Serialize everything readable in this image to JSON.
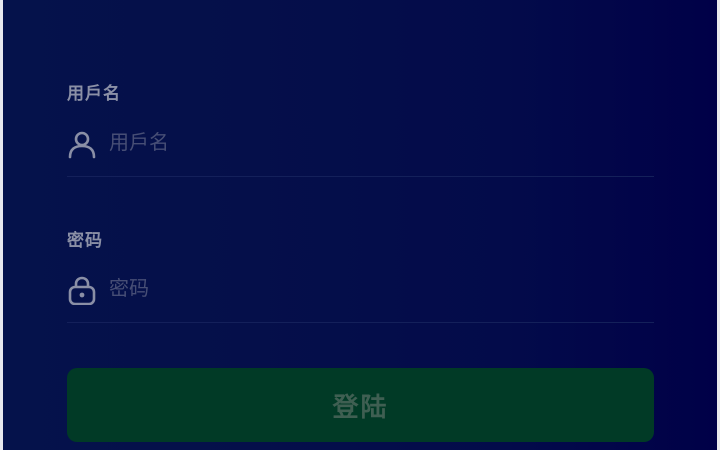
{
  "form": {
    "username": {
      "label": "用戶名",
      "placeholder": "用戶名",
      "value": "",
      "icon": "user-icon"
    },
    "password": {
      "label": "密码",
      "placeholder": "密码",
      "value": "",
      "icon": "lock-icon"
    },
    "submit_label": "登陆"
  },
  "colors": {
    "background": "#050f4a",
    "button": "#013a26",
    "label_text": "#8b90a6",
    "placeholder_text": "#474e75"
  }
}
